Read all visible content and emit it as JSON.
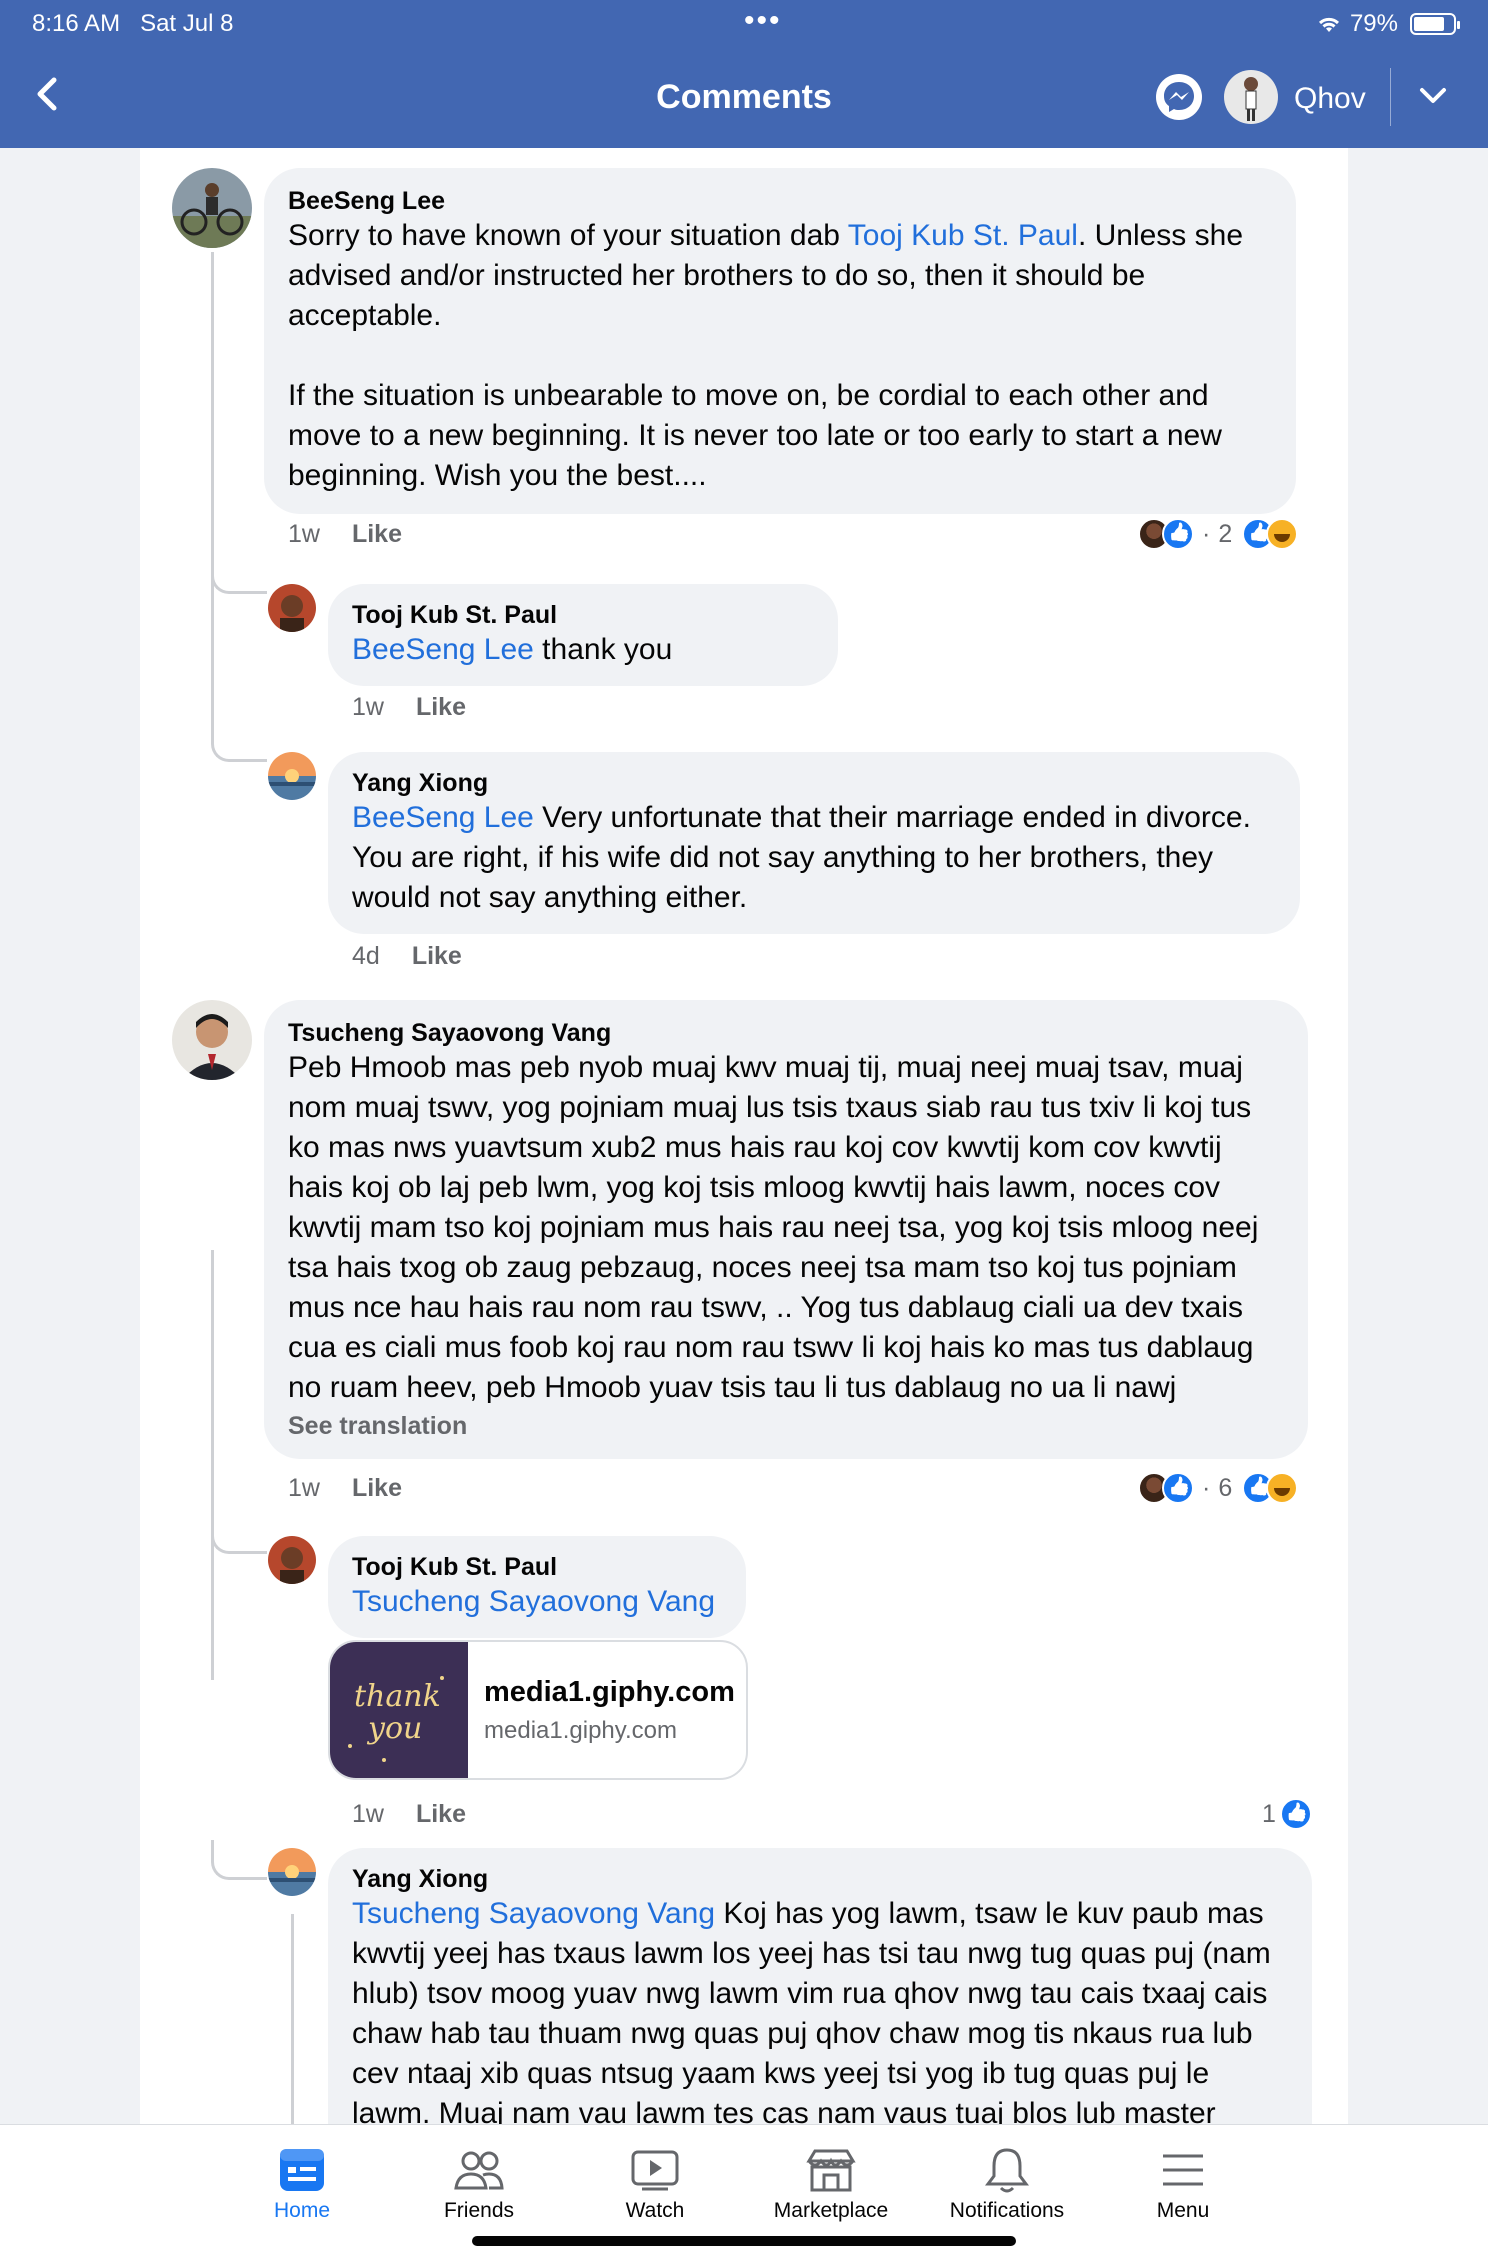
{
  "status": {
    "time": "8:16 AM",
    "date": "Sat Jul 8",
    "battery": "79%",
    "battery_level": 0.79
  },
  "header": {
    "title": "Comments",
    "user_name": "Qhov"
  },
  "comments": [
    {
      "author": "BeeSeng Lee",
      "text_before": "Sorry to have known of your situation dab ",
      "mention": "Tooj Kub St. Paul",
      "text_after": ".  Unless she advised and/or instructed her brothers to do so, then it should be acceptable.\n\nIf the situation is unbearable to move on, be cordial to each other and move to a new beginning.  It is never too late or too early to start a new beginning.  Wish you the best....",
      "time": "1w",
      "like": "Like",
      "reaction_count": "2"
    },
    {
      "author": "Tooj Kub St. Paul",
      "mention": "BeeSeng Lee",
      "text_after": " thank you",
      "time": "1w",
      "like": "Like"
    },
    {
      "author": "Yang Xiong",
      "mention": "BeeSeng Lee",
      "text_after": " Very unfortunate that their marriage ended in divorce. You are right, if his wife did not say anything to her brothers, they would not say anything either.",
      "time": "4d",
      "like": "Like"
    },
    {
      "author": "Tsucheng Sayaovong Vang",
      "text": "Peb Hmoob mas peb nyob muaj kwv muaj tij, muaj neej muaj tsav, muaj nom muaj tswv, yog pojniam muaj lus tsis txaus siab rau tus txiv li koj tus ko mas nws yuavtsum xub2 mus hais rau koj cov kwvtij kom cov kwvtij hais koj ob laj peb lwm, yog koj tsis mloog kwvtij hais lawm, noces cov kwvtij mam tso koj pojniam mus hais rau neej tsa, yog koj tsis mloog neej tsa hais txog ob zaug pebzaug, noces neej tsa mam tso koj tus pojniam mus nce hau hais rau nom rau tswv, .. Yog tus dablaug ciali ua dev txais cua es ciali mus foob koj rau nom rau tswv li koj hais ko mas tus dablaug no ruam heev, peb Hmoob yuav tsis tau li tus dablaug no ua li nawj",
      "see_translation": "See translation",
      "time": "1w",
      "like": "Like",
      "reaction_count": "6"
    },
    {
      "author": "Tooj Kub St. Paul",
      "mention": "Tsucheng Sayaovong Vang",
      "link_title": "media1.giphy.com",
      "link_domain": "media1.giphy.com",
      "gif_text": "thank you",
      "time": "1w",
      "like": "Like",
      "reaction_count": "1"
    },
    {
      "author": "Yang Xiong",
      "mention": "Tsucheng Sayaovong Vang",
      "text_after": " Koj has yog lawm, tsaw le kuv paub mas kwvtij yeej has txaus lawm los yeej has tsi tau nwg tug quas puj (nam hlub) tsov moog yuav nwg lawm vim rua qhov nwg tau cais txaaj cais chaw hab tau thuam nwg quas puj qhov chaw mog tis nkaus rua lub cev ntaaj xib quas ntsug yaam kws yeej tsi yog ib tug quas puj le lawm. Muaj nam vau lawm tes cas nam vaus tuaj blos lub master"
    }
  ],
  "tabs": [
    {
      "label": "Home",
      "icon": "home-icon",
      "active": true
    },
    {
      "label": "Friends",
      "icon": "friends-icon"
    },
    {
      "label": "Watch",
      "icon": "watch-icon"
    },
    {
      "label": "Marketplace",
      "icon": "marketplace-icon"
    },
    {
      "label": "Notifications",
      "icon": "bell-icon"
    },
    {
      "label": "Menu",
      "icon": "menu-icon"
    }
  ],
  "colors": {
    "header": "#4267b2",
    "mention": "#216fdb",
    "bubble": "#f0f2f5",
    "active_tab": "#1877f2"
  }
}
